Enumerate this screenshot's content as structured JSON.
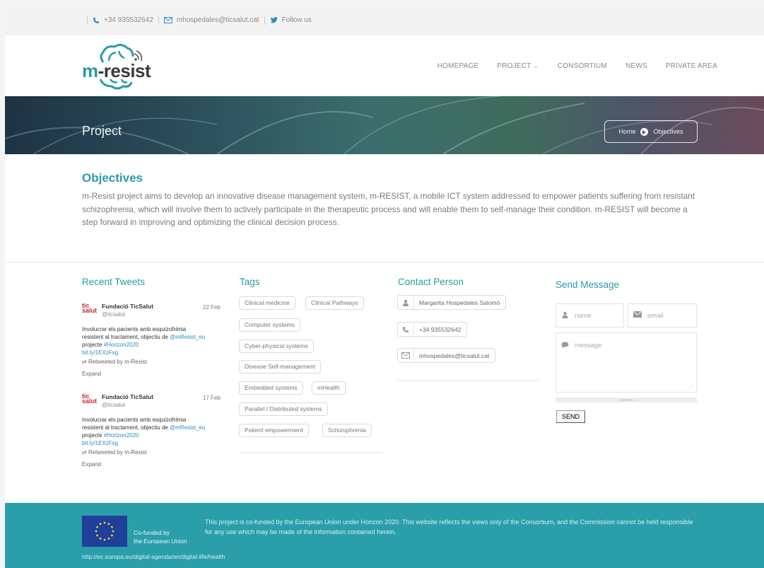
{
  "topbar": {
    "phone": "+34 935532642",
    "email": "mhospedales@ticsalut.cat",
    "follow": "Follow us"
  },
  "brand": {
    "logo_m": "m",
    "logo_rest": "-resist"
  },
  "nav": {
    "items": [
      "HOMEPAGE",
      "PROJECT",
      "CONSORTIUM",
      "NEWS",
      "PRIVATE AREA"
    ],
    "project_chevron": "⌄"
  },
  "banner": {
    "title": "Project",
    "breadcrumb_home": "Home",
    "breadcrumb_current": "Objectives"
  },
  "objectives": {
    "heading": "Objectives",
    "text": "m-Resist project aims to develop an innovative disease management system, m-RESIST, a mobile ICT system addressed to empower patients suffering from resistant schizophrenia, which will involve them to actively participate in the therapeutic process and will enable them to self-manage their condition. m-RESIST will become a step forward in improving and optimizing the clinical decision process."
  },
  "tweets": {
    "title": "Recent Tweets",
    "logo_line1": "tic",
    "logo_line2": "salut",
    "items": [
      {
        "name": "Fundació TicSalut",
        "handle": "@ticsalut",
        "date": "22 Feb",
        "body": "Involucrar els pacients amb esquizofrènia resistent al tractament, objectiu de",
        "mention": "@mResist_eu",
        "mid": " projecte ",
        "hashtag": "#Horizon2020",
        "url": "bit.ly/1EXzFsg",
        "retweet": "Retweeted by m-Resist",
        "expand": "Expand"
      },
      {
        "name": "Fundació TicSalut",
        "handle": "@ticsalut",
        "date": "17 Feb",
        "body": "Involucrar els pacients amb esquizofrènia resistent al tractament, objectiu de",
        "mention": "@mResist_eu",
        "mid": " projecte ",
        "hashtag": "#Horizon2020",
        "url": "bit.ly/1EXzFsg",
        "retweet": "Retweeted by m-Resist",
        "expand": "Expand"
      }
    ]
  },
  "tags": {
    "title": "Tags",
    "items": [
      "Clinical medicine",
      "Clinical Pathways",
      "Computer systems",
      "Cyber-physical systems",
      "Disease Self-management",
      "Embedded systems",
      "mHealth",
      "Parallel / Distributed systems",
      "Patient empowerment",
      "Schizophrenia"
    ]
  },
  "contact": {
    "title": "Contact Person",
    "name": "Margarita Hospedales Salomó",
    "phone": "+34 935532642",
    "email": "mhospedales@ticsalut.cat"
  },
  "message": {
    "title": "Send Message",
    "name_placeholder": "name",
    "email_placeholder": "email",
    "message_placeholder": "message",
    "send_label": "SEND"
  },
  "footer": {
    "cofunded_line1": "Co-funded by",
    "cofunded_line2": "the European Union",
    "note": "This project is co-funded by the European Union under Horizon 2020. This website reflects the views only of the Consortium, and the Commission cannot be held responsible for any use which may be made of the information contained herein.",
    "link": "http://ec.europa.eu/digital-agenda/en/digital-life/health"
  },
  "colors": {
    "accent": "#2b9aa6",
    "footer_bg": "#2a9fa9"
  }
}
